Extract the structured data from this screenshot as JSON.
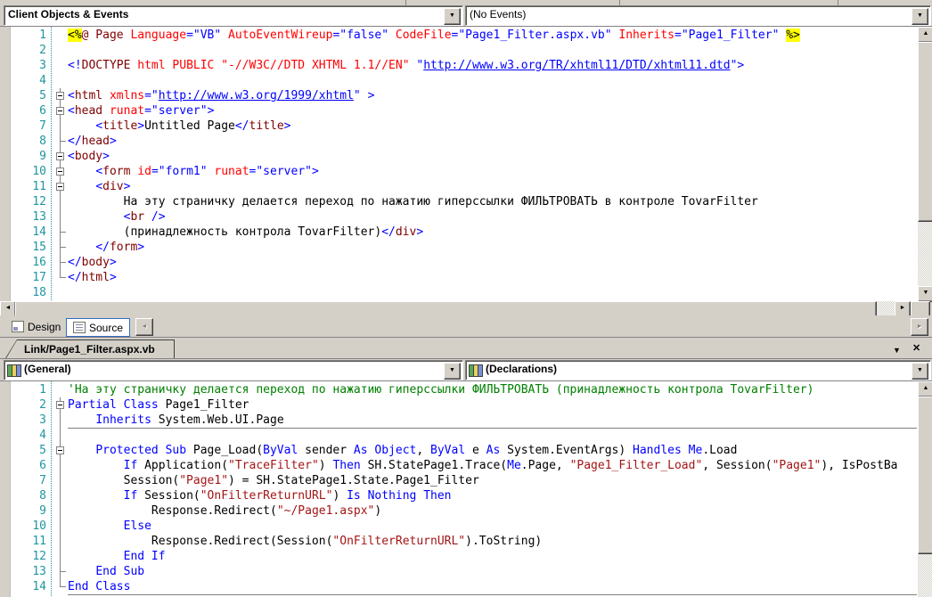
{
  "top_pane": {
    "members_dropdown": "Client Objects & Events",
    "events_dropdown": "(No Events)",
    "code_lines": [
      {
        "n": 1,
        "f": "",
        "t": [
          [
            "h",
            "<%"
          ],
          [
            "m",
            "@ Page "
          ],
          [
            "a",
            "Language"
          ],
          [
            "v",
            "=\"VB\""
          ],
          [
            "p",
            " "
          ],
          [
            "a",
            "AutoEventWireup"
          ],
          [
            "v",
            "=\"false\""
          ],
          [
            "p",
            " "
          ],
          [
            "a",
            "CodeFile"
          ],
          [
            "v",
            "=\"Page1_Filter.aspx.vb\""
          ],
          [
            "p",
            " "
          ],
          [
            "a",
            "Inherits"
          ],
          [
            "v",
            "=\"Page1_Filter\""
          ],
          [
            "p",
            " "
          ],
          [
            "h",
            "%>"
          ]
        ]
      },
      {
        "n": 2,
        "f": "",
        "t": []
      },
      {
        "n": 3,
        "f": "",
        "t": [
          [
            "d",
            "<!"
          ],
          [
            "m",
            "DOCTYPE"
          ],
          [
            "a",
            " html PUBLIC"
          ],
          [
            "p",
            " "
          ],
          [
            "a",
            "\"-//W3C//DTD XHTML 1.1//EN\""
          ],
          [
            "p",
            " "
          ],
          [
            "v",
            "\""
          ],
          [
            "u",
            "http://www.w3.org/TR/xhtml11/DTD/xhtml11.dtd"
          ],
          [
            "v",
            "\""
          ],
          [
            "d",
            ">"
          ]
        ]
      },
      {
        "n": 4,
        "f": "",
        "t": []
      },
      {
        "n": 5,
        "f": "box",
        "t": [
          [
            "d",
            "<"
          ],
          [
            "m",
            "html"
          ],
          [
            "p",
            " "
          ],
          [
            "a",
            "xmlns"
          ],
          [
            "v",
            "=\""
          ],
          [
            "u",
            "http://www.w3.org/1999/xhtml"
          ],
          [
            "v",
            "\""
          ],
          [
            "p",
            " "
          ],
          [
            "d",
            ">"
          ]
        ]
      },
      {
        "n": 6,
        "f": "box",
        "t": [
          [
            "d",
            "<"
          ],
          [
            "m",
            "head"
          ],
          [
            "p",
            " "
          ],
          [
            "a",
            "runat"
          ],
          [
            "v",
            "=\"server\""
          ],
          [
            "d",
            ">"
          ]
        ]
      },
      {
        "n": 7,
        "f": "line",
        "t": [
          [
            "p",
            "    "
          ],
          [
            "d",
            "<"
          ],
          [
            "m",
            "title"
          ],
          [
            "d",
            ">"
          ],
          [
            "p",
            "Untitled Page"
          ],
          [
            "d",
            "</"
          ],
          [
            "m",
            "title"
          ],
          [
            "d",
            ">"
          ]
        ]
      },
      {
        "n": 8,
        "f": "tick",
        "t": [
          [
            "d",
            "</"
          ],
          [
            "m",
            "head"
          ],
          [
            "d",
            ">"
          ]
        ]
      },
      {
        "n": 9,
        "f": "box",
        "t": [
          [
            "d",
            "<"
          ],
          [
            "m",
            "body"
          ],
          [
            "d",
            ">"
          ]
        ]
      },
      {
        "n": 10,
        "f": "box",
        "t": [
          [
            "p",
            "    "
          ],
          [
            "d",
            "<"
          ],
          [
            "m",
            "form"
          ],
          [
            "p",
            " "
          ],
          [
            "a",
            "id"
          ],
          [
            "v",
            "=\"form1\""
          ],
          [
            "p",
            " "
          ],
          [
            "a",
            "runat"
          ],
          [
            "v",
            "=\"server\""
          ],
          [
            "d",
            ">"
          ]
        ]
      },
      {
        "n": 11,
        "f": "box",
        "t": [
          [
            "p",
            "    "
          ],
          [
            "d",
            "<"
          ],
          [
            "m",
            "div"
          ],
          [
            "d",
            ">"
          ]
        ]
      },
      {
        "n": 12,
        "f": "line",
        "t": [
          [
            "p",
            "        На эту страничку делается переход по нажатию гиперссылки ФИЛЬТРОВАТЬ в контроле TovarFilter"
          ]
        ]
      },
      {
        "n": 13,
        "f": "line",
        "t": [
          [
            "p",
            "        "
          ],
          [
            "d",
            "<"
          ],
          [
            "m",
            "br"
          ],
          [
            "d",
            " />"
          ]
        ]
      },
      {
        "n": 14,
        "f": "tick",
        "t": [
          [
            "p",
            "        (принадлежность контрола TovarFilter)"
          ],
          [
            "d",
            "</"
          ],
          [
            "m",
            "div"
          ],
          [
            "d",
            ">"
          ]
        ]
      },
      {
        "n": 15,
        "f": "tick",
        "t": [
          [
            "p",
            "    "
          ],
          [
            "d",
            "</"
          ],
          [
            "m",
            "form"
          ],
          [
            "d",
            ">"
          ]
        ]
      },
      {
        "n": 16,
        "f": "tick",
        "t": [
          [
            "d",
            "</"
          ],
          [
            "m",
            "body"
          ],
          [
            "d",
            ">"
          ]
        ]
      },
      {
        "n": 17,
        "f": "end",
        "t": [
          [
            "d",
            "</"
          ],
          [
            "m",
            "html"
          ],
          [
            "d",
            ">"
          ]
        ]
      },
      {
        "n": 18,
        "f": "",
        "t": []
      }
    ]
  },
  "view_tabs": {
    "design": "Design",
    "source": "Source"
  },
  "bottom_pane": {
    "tab_label": "Link/Page1_Filter.aspx.vb",
    "general_dropdown": "(General)",
    "declarations_dropdown": "(Declarations)",
    "separators_after": [
      3,
      14
    ],
    "code_lines": [
      {
        "n": 1,
        "f": "",
        "t": [
          [
            "c",
            "'На эту страничку делается переход по нажатию гиперссылки ФИЛЬТРОВАТЬ (принадлежность контрола TovarFilter)"
          ]
        ]
      },
      {
        "n": 2,
        "f": "box",
        "t": [
          [
            "k",
            "Partial Class"
          ],
          [
            "p",
            " Page1_Filter"
          ]
        ]
      },
      {
        "n": 3,
        "f": "line",
        "t": [
          [
            "p",
            "    "
          ],
          [
            "k",
            "Inherits"
          ],
          [
            "p",
            " System.Web.UI.Page"
          ]
        ]
      },
      {
        "n": 4,
        "f": "line",
        "t": []
      },
      {
        "n": 5,
        "f": "box",
        "t": [
          [
            "p",
            "    "
          ],
          [
            "k",
            "Protected Sub"
          ],
          [
            "p",
            " Page_Load("
          ],
          [
            "k",
            "ByVal"
          ],
          [
            "p",
            " sender "
          ],
          [
            "k",
            "As Object"
          ],
          [
            "p",
            ", "
          ],
          [
            "k",
            "ByVal"
          ],
          [
            "p",
            " e "
          ],
          [
            "k",
            "As"
          ],
          [
            "p",
            " System.EventArgs) "
          ],
          [
            "k",
            "Handles"
          ],
          [
            "p",
            " "
          ],
          [
            "k",
            "Me"
          ],
          [
            "p",
            ".Load"
          ]
        ]
      },
      {
        "n": 6,
        "f": "line",
        "t": [
          [
            "p",
            "        "
          ],
          [
            "k",
            "If"
          ],
          [
            "p",
            " Application("
          ],
          [
            "s",
            "\"TraceFilter\""
          ],
          [
            "p",
            ") "
          ],
          [
            "k",
            "Then"
          ],
          [
            "p",
            " SH.StatePage1.Trace("
          ],
          [
            "k",
            "Me"
          ],
          [
            "p",
            ".Page, "
          ],
          [
            "s",
            "\"Page1_Filter_Load\""
          ],
          [
            "p",
            ", Session("
          ],
          [
            "s",
            "\"Page1\""
          ],
          [
            "p",
            "), IsPostBa"
          ]
        ]
      },
      {
        "n": 7,
        "f": "line",
        "t": [
          [
            "p",
            "        Session("
          ],
          [
            "s",
            "\"Page1\""
          ],
          [
            "p",
            ") = SH.StatePage1.State.Page1_Filter"
          ]
        ]
      },
      {
        "n": 8,
        "f": "line",
        "t": [
          [
            "p",
            "        "
          ],
          [
            "k",
            "If"
          ],
          [
            "p",
            " Session("
          ],
          [
            "s",
            "\"OnFilterReturnURL\""
          ],
          [
            "p",
            ") "
          ],
          [
            "k",
            "Is Nothing Then"
          ]
        ]
      },
      {
        "n": 9,
        "f": "line",
        "t": [
          [
            "p",
            "            Response.Redirect("
          ],
          [
            "s",
            "\"~/Page1.aspx\""
          ],
          [
            "p",
            ")"
          ]
        ]
      },
      {
        "n": 10,
        "f": "line",
        "t": [
          [
            "p",
            "        "
          ],
          [
            "k",
            "Else"
          ]
        ]
      },
      {
        "n": 11,
        "f": "line",
        "t": [
          [
            "p",
            "            Response.Redirect(Session("
          ],
          [
            "s",
            "\"OnFilterReturnURL\""
          ],
          [
            "p",
            ").ToString)"
          ]
        ]
      },
      {
        "n": 12,
        "f": "line",
        "t": [
          [
            "p",
            "        "
          ],
          [
            "k",
            "End If"
          ]
        ]
      },
      {
        "n": 13,
        "f": "tick",
        "t": [
          [
            "p",
            "    "
          ],
          [
            "k",
            "End Sub"
          ]
        ]
      },
      {
        "n": 14,
        "f": "end",
        "t": [
          [
            "k",
            "End Class"
          ]
        ]
      }
    ]
  },
  "icons": {
    "dropdown_arrow": "▼",
    "scroll_up": "▲",
    "scroll_down": "▼",
    "scroll_left": "◄",
    "scroll_right": "►",
    "chevron_down": "▼",
    "close": "✕"
  }
}
